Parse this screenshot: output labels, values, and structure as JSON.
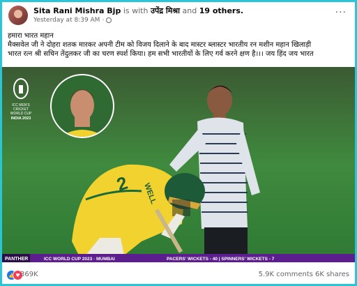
{
  "post": {
    "author": "Sita Rani Mishra Bjp",
    "with_text": "is with",
    "tagged": "उपेंद्र मिश्रा",
    "and_text": "and",
    "others": "19 others.",
    "timestamp": "Yesterday at 8:39 AM",
    "more": "···",
    "text_lines": [
      "हमारा भारत महान",
      "मैक्सवेल जी ने दोहरा शतक मारकर अपनी टीम को विजय दिलाने के बाद मास्टर ब्लास्टर भारतीय रन मशीन महान खिलाड़ी",
      "भारत रत्न श्री सचिन तेंदुलकर जी का चरण स्पर्श किया। हम सभी भारतीयों के लिए गर्व करने क्षण है।।। जय हिंद जय भारत"
    ]
  },
  "photo": {
    "logo_lines": [
      "ICC MEN'S",
      "CRICKET",
      "WORLD CUP",
      "INDIA 2023"
    ],
    "jersey_text": "WELL",
    "jersey_number": "2",
    "ticker_brand": "PANTHER",
    "ticker_event": "ICC WORLD CUP 2023 · MUMBAI",
    "ticker_stats": "PACERS' WICKETS - 40 | SPINNERS' WICKETS - 7"
  },
  "engagement": {
    "reactions": "369K",
    "comments": "5.9K comments",
    "shares": "6K shares"
  },
  "colors": {
    "border": "#29c6d8",
    "ticker_purple": "#5b1e8c",
    "jersey_yellow": "#f2d22e",
    "like_blue": "#1877f2"
  }
}
